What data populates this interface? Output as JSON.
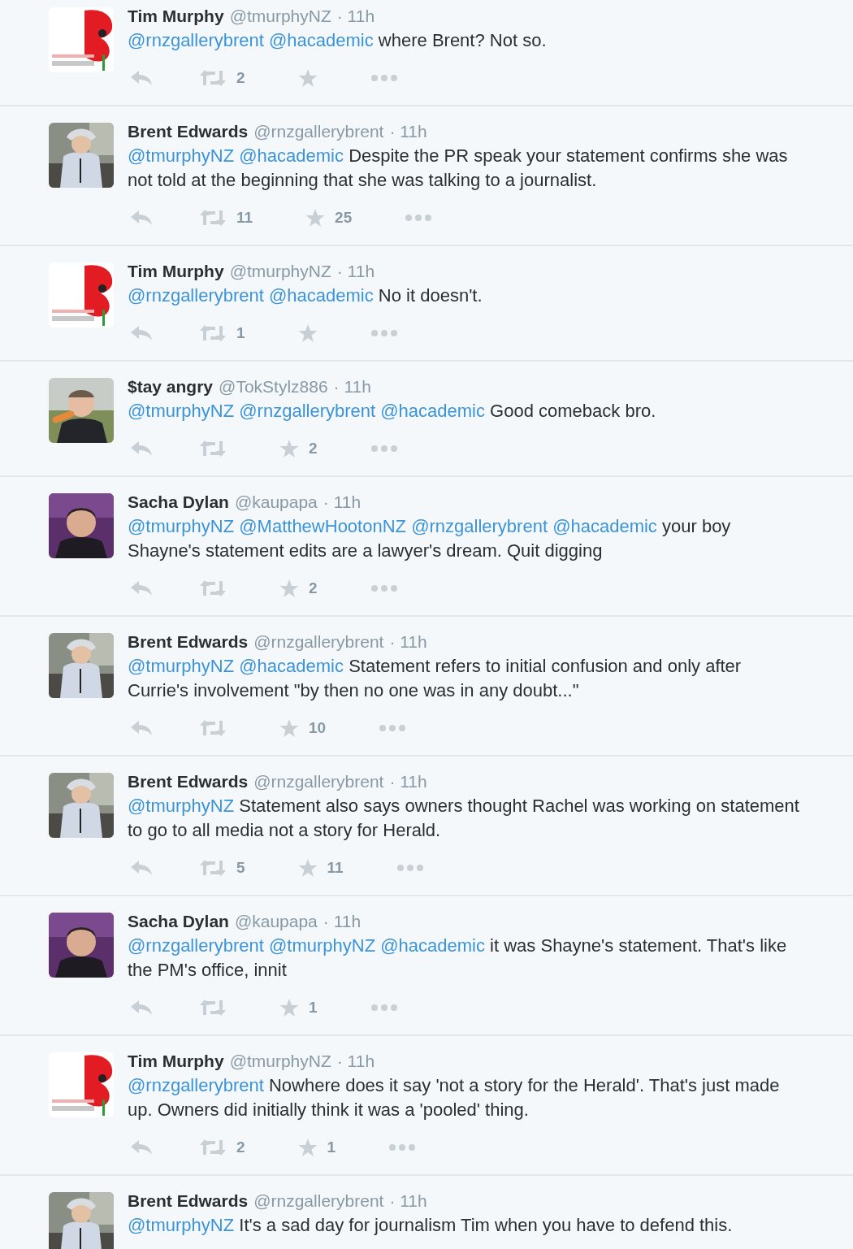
{
  "tweets": [
    {
      "name": "Tim Murphy",
      "handle": "@tmurphyNZ",
      "time": "· 11h",
      "avatar": {
        "kind": "picture"
      },
      "mentions": [
        "@rnzgallerybrent",
        "@hacademic"
      ],
      "text": " where Brent? Not so.",
      "retweets": "2"
    },
    {
      "name": "Brent Edwards",
      "handle": "@rnzgallerybrent",
      "time": "· 11h",
      "avatar": {
        "kind": "picture"
      },
      "mentions": [
        "@tmurphyNZ",
        "@hacademic"
      ],
      "text": "Despite the PR speak your statement confirms she was not told at the beginning that she was talking to a journalist.",
      "retweets": "11",
      "favorites": "25"
    },
    {
      "name": "Tim Murphy",
      "handle": "@tmurphyNZ",
      "time": "· 11h",
      "avatar": {
        "kind": "picture"
      },
      "mentions": [
        "@rnzgallerybrent",
        "@hacademic"
      ],
      "text": "No it doesn't.",
      "retweets": "1"
    },
    {
      "name": "$tay angry",
      "handle": "@TokStylz886",
      "time": "· 11h",
      "avatar": {
        "kind": "picture"
      },
      "mentions": [
        "@tmurphyNZ",
        "@rnzgallerybrent",
        "@hacademic"
      ],
      "text": "Good comeback bro.",
      "favorites": "2"
    },
    {
      "name": "Sacha Dylan",
      "handle": "@kaupapa",
      "time": "· 11h",
      "avatar": {
        "kind": "picture"
      },
      "mentions": [
        "@tmurphyNZ",
        "@MatthewHootonNZ",
        "@rnzgallerybrent",
        "@hacademic"
      ],
      "text": "your boy Shayne's statement edits are a lawyer's dream. Quit digging",
      "favorites": "2"
    },
    {
      "name": "Brent Edwards",
      "handle": "@rnzgallerybrent",
      "time": "· 11h",
      "avatar": {
        "kind": "picture"
      },
      "mentions": [
        "@tmurphyNZ",
        "@hacademic"
      ],
      "text": "Statement refers to initial confusion and only after Currie's involvement \"by then no one was in any doubt...\"",
      "favorites": "10"
    },
    {
      "name": "Brent Edwards",
      "handle": "@rnzgallerybrent",
      "time": "· 11h",
      "avatar": {
        "kind": "picture"
      },
      "mentions": [
        "@tmurphyNZ"
      ],
      "text": "Statement also says owners thought Rachel was working on statement to go to all media not a story for Herald.",
      "retweets": "5",
      "favorites": "11"
    },
    {
      "name": "Sacha Dylan",
      "handle": "@kaupapa",
      "time": "· 11h",
      "avatar": {
        "kind": "picture"
      },
      "mentions": [
        "@rnzgallerybrent",
        "@tmurphyNZ",
        "@hacademic"
      ],
      "text": "it was Shayne's statement. That's like the PM's office, innit",
      "favorites": "1"
    },
    {
      "name": "Tim Murphy",
      "handle": "@tmurphyNZ",
      "time": "· 11h",
      "avatar": {
        "kind": "picture"
      },
      "mentions": [
        "@rnzgallerybrent"
      ],
      "text": "Nowhere does it say 'not a story for the Herald'. That's just made up. Owners did initially think it was a 'pooled' thing.",
      "retweets": "2",
      "favorites": "1"
    },
    {
      "name": "Brent Edwards",
      "handle": "@rnzgallerybrent",
      "time": "· 11h",
      "avatar": {
        "kind": "picture"
      },
      "mentions": [
        "@tmurphyNZ"
      ],
      "text": "It's a sad day for journalism Tim when you have to defend this."
    }
  ]
}
